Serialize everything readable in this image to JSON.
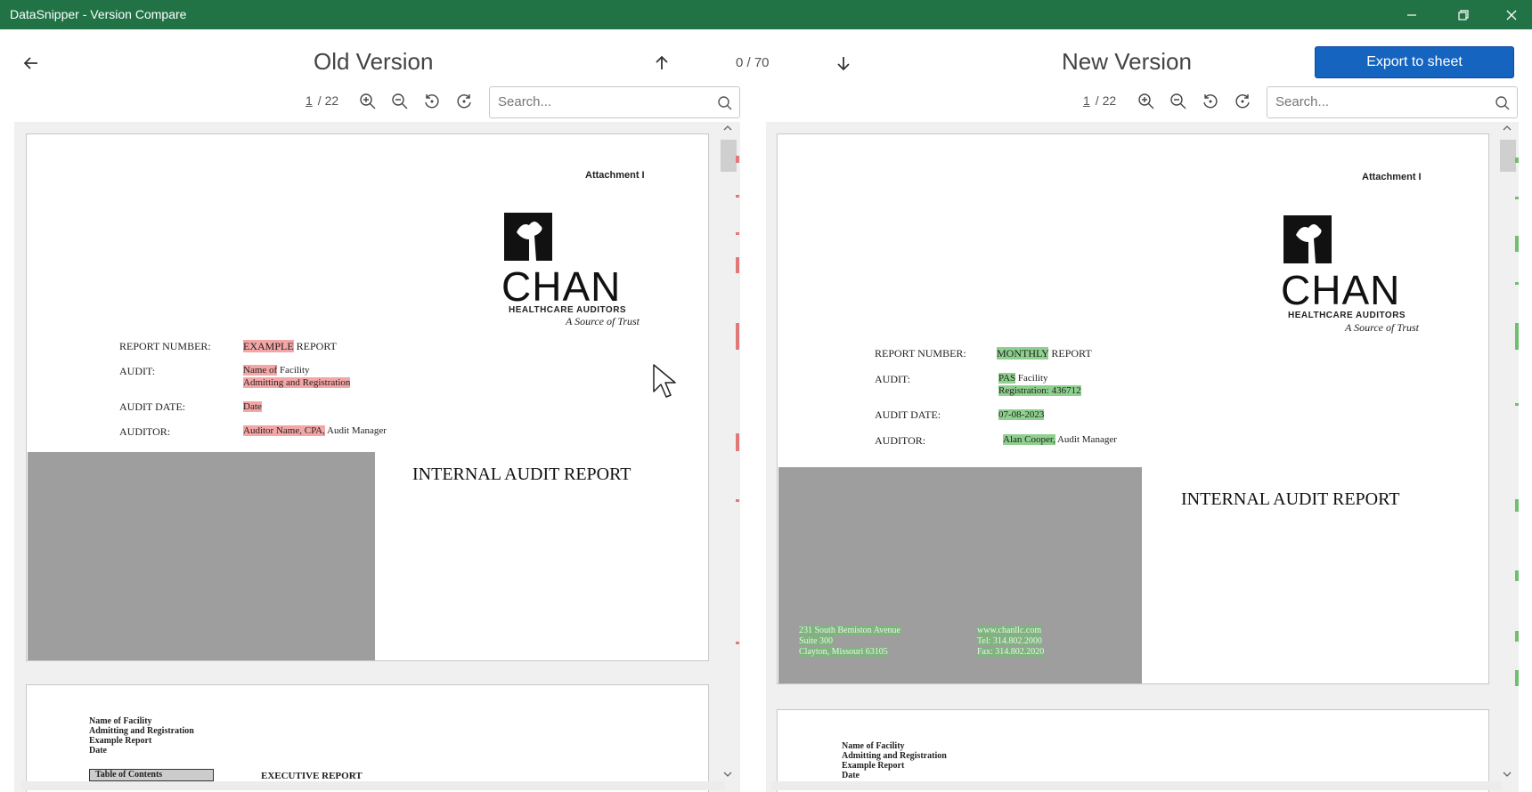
{
  "window": {
    "title": "DataSnipper - Version Compare"
  },
  "header": {
    "old_title": "Old Version",
    "new_title": "New Version",
    "counter": "0 / 70",
    "export_label": "Export to sheet"
  },
  "left_toolbar": {
    "page_current": "1",
    "page_total": "/  22",
    "search_placeholder": "Search..."
  },
  "right_toolbar": {
    "page_current": "1",
    "page_total": "/  22",
    "search_placeholder": "Search..."
  },
  "old_doc": {
    "attachment": "Attachment I",
    "brand": "CHAN",
    "brand_sub": "HEALTHCARE AUDITORS",
    "tagline": "A Source of Trust",
    "report_number_label": "REPORT NUMBER:",
    "report_number_hl": "EXAMPLE",
    "report_number_rest": " REPORT",
    "audit_label": "AUDIT:",
    "audit_hl": "Name of",
    "audit_rest": " Facility",
    "audit_line2": "Admitting and Registration",
    "audit_date_label": "AUDIT DATE:",
    "audit_date_value": "Date",
    "auditor_label": "AUDITOR:",
    "auditor_hl": "Auditor Name, CPA,",
    "auditor_rest": " Audit Manager",
    "report_title": "INTERNAL AUDIT REPORT",
    "p2_lines": [
      "Name of Facility",
      "Admitting and Registration",
      "Example Report",
      "Date"
    ],
    "toc": "Table of Contents",
    "exec": "EXECUTIVE REPORT"
  },
  "new_doc": {
    "attachment": "Attachment I",
    "brand": "CHAN",
    "brand_sub": "HEALTHCARE AUDITORS",
    "tagline": "A Source of Trust",
    "report_number_label": "REPORT NUMBER:",
    "report_number_hl": "MONTHLY",
    "report_number_rest": " REPORT",
    "audit_label": "AUDIT:",
    "audit_hl": "PAS",
    "audit_rest": " Facility",
    "audit_line2": "Registration: 436712",
    "audit_date_label": "AUDIT DATE:",
    "audit_date_value": "07-08-2023",
    "auditor_label": "AUDITOR:",
    "auditor_hl": "Alan Cooper,",
    "auditor_rest": " Audit Manager",
    "report_title": "INTERNAL AUDIT REPORT",
    "address": [
      "231 South Bemiston Avenue",
      "Suite 300",
      "Clayton, Missouri  63105"
    ],
    "contact": [
      "www.chanllc.com",
      "Tel: 314.802.2000",
      "Fax: 314.802.2020"
    ],
    "p2_lines": [
      "Name of Facility",
      "Admitting and Registration",
      "Example Report",
      "Date"
    ]
  },
  "colors": {
    "titlebar": "#217346",
    "accent": "#1565c0",
    "removed": "#f4a6a6",
    "added": "#8ed08e"
  },
  "icons": [
    "back-arrow-icon",
    "up-arrow-icon",
    "down-arrow-icon",
    "zoom-in-icon",
    "zoom-out-icon",
    "rotate-left-icon",
    "rotate-right-icon",
    "search-icon",
    "minimize-icon",
    "restore-icon",
    "close-icon",
    "mouse-cursor-icon"
  ]
}
